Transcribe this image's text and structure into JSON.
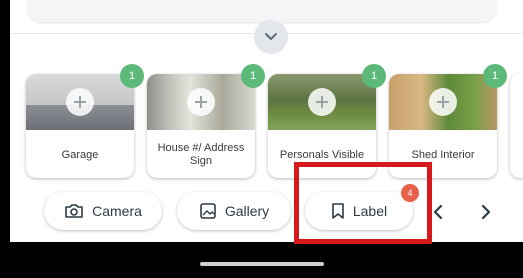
{
  "photo_tiles": [
    {
      "label": "Garage",
      "count": "1"
    },
    {
      "label": "House #/ Address Sign",
      "count": "1"
    },
    {
      "label": "Personals Visible",
      "count": "1"
    },
    {
      "label": "Shed Interior",
      "count": "1"
    }
  ],
  "actions": {
    "camera_label": "Camera",
    "gallery_label": "Gallery",
    "label_label": "Label",
    "label_badge": "4"
  },
  "icons": {
    "expand": "chevron-down-icon",
    "add": "plus-icon",
    "camera": "camera-icon",
    "gallery": "image-icon",
    "label": "bookmark-icon",
    "prev": "chevron-left-icon",
    "next": "chevron-right-icon"
  },
  "colors": {
    "count_badge": "#5cb97a",
    "label_badge": "#e8604a",
    "highlight": "#d6191b"
  }
}
